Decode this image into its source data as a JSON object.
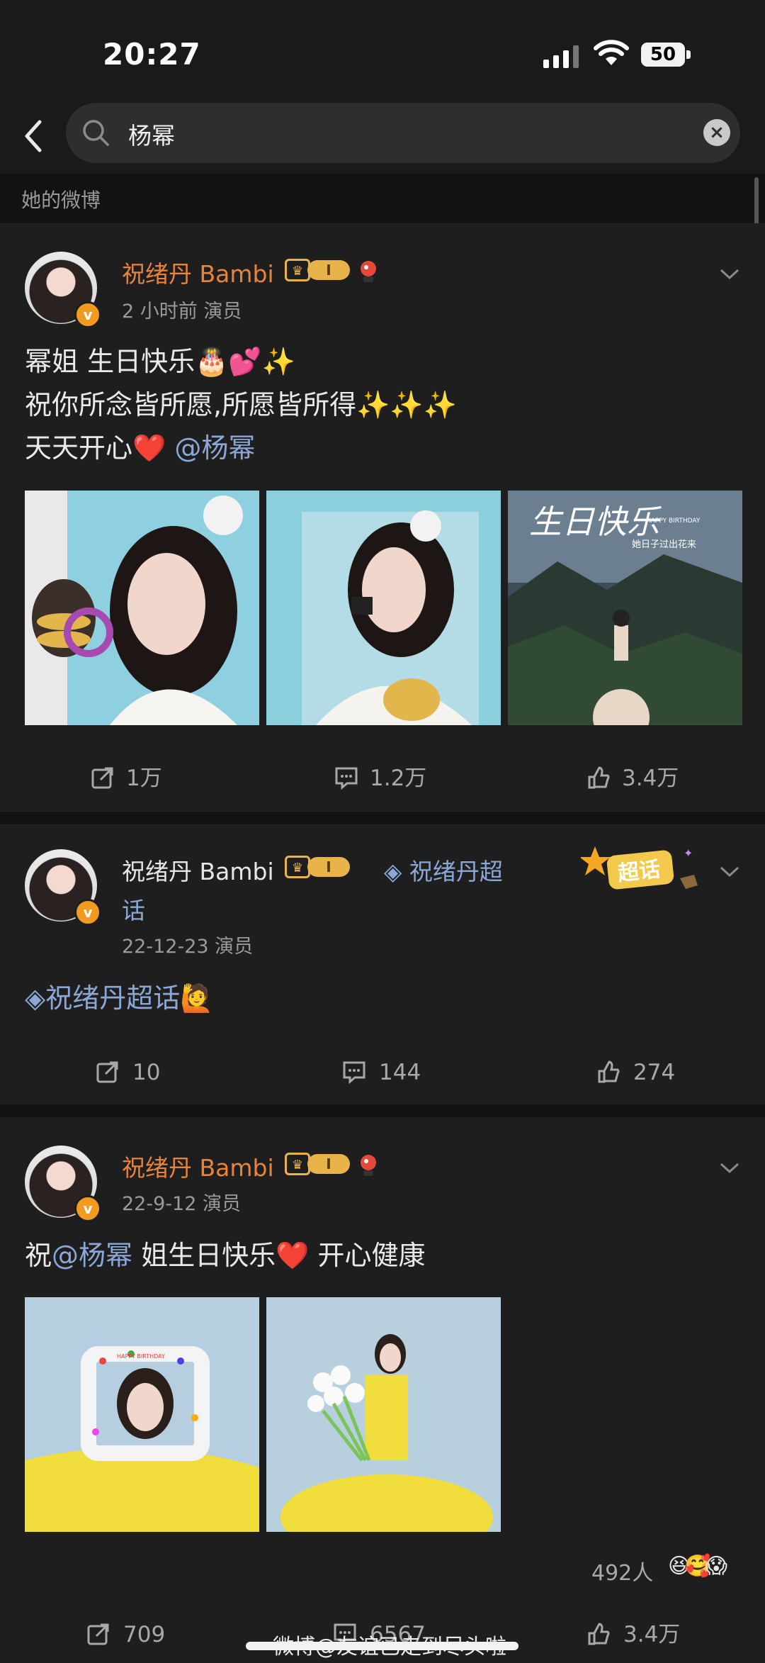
{
  "status": {
    "time": "20:27",
    "battery": "50"
  },
  "search": {
    "query": "杨幂"
  },
  "section": {
    "title": "她的微博"
  },
  "posts": [
    {
      "username": "祝绪丹 Bambi",
      "level": "I",
      "meta": "2 小时前  演员",
      "lines": [
        "幂姐 生日快乐🎂💕✨",
        "祝你所念皆所愿,所愿皆所得✨✨✨"
      ],
      "line3_prefix": "天天开心❤️ ",
      "line3_mention": "@杨幂",
      "photo_text": {
        "title": "生日快乐",
        "sub": "HAPPY BIRTHDAY",
        "caption": "她日子过出花来"
      },
      "reposts": "1万",
      "comments": "1.2万",
      "likes": "3.4万"
    },
    {
      "username": "祝绪丹 Bambi",
      "level": "I",
      "topic_a": "◈ 祝绪丹超",
      "topic_b": "话",
      "badge": "超话",
      "meta": "22-12-23  演员",
      "text_prefix": "◈祝绪丹超话",
      "text_emoji": "🙋",
      "reposts": "10",
      "comments": "144",
      "likes": "274"
    },
    {
      "username": "祝绪丹 Bambi",
      "level": "I",
      "meta": "22-9-12  演员",
      "text_prefix": "祝",
      "text_mention": "@杨幂",
      "text_suffix": " 姐生日快乐❤️ 开心健康",
      "photo_frame_text": "HAPPY BIRTHDAY",
      "reaction_count": "492人",
      "reaction_emojis": "😆🥰😱",
      "reposts": "709",
      "comments": "6567",
      "likes": "3.4万"
    }
  ],
  "watermark": "微博@友谊已走到尽头啦"
}
